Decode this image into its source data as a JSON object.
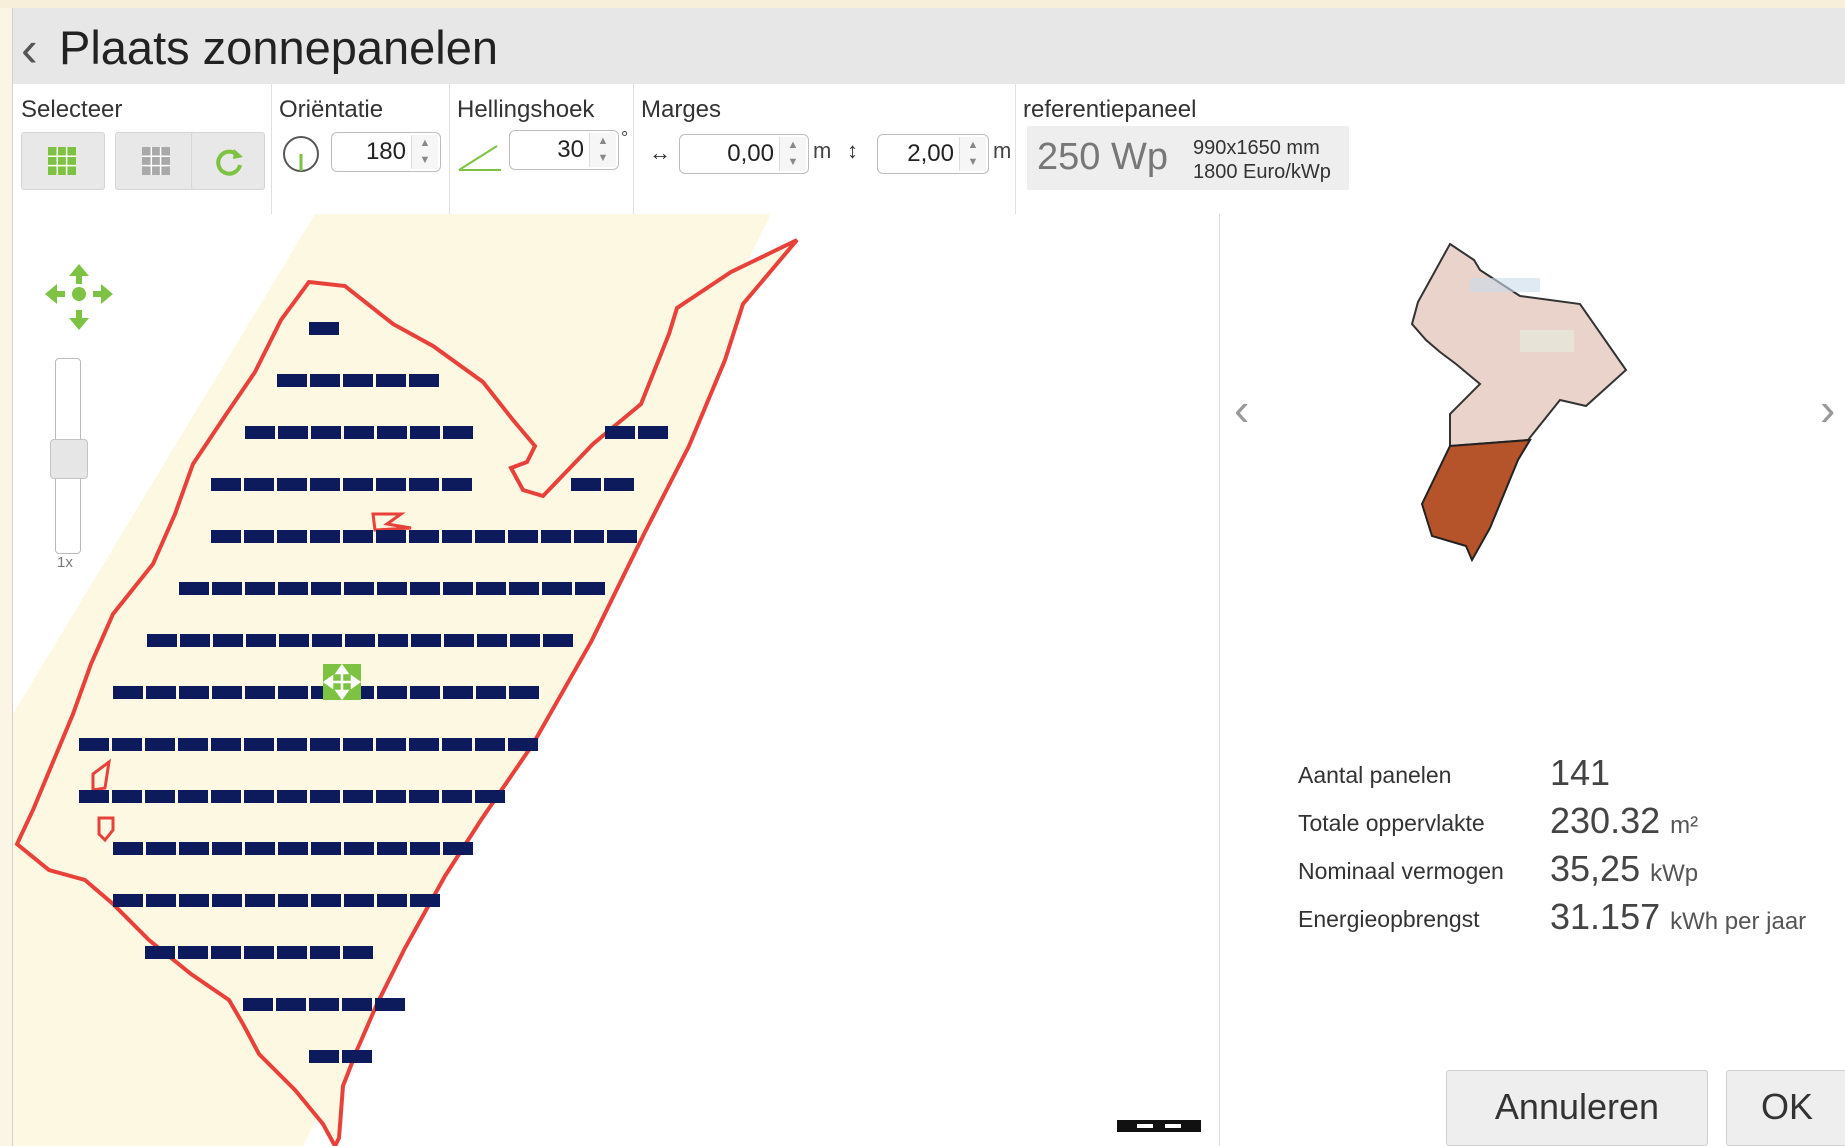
{
  "window": {
    "title": "Plaats zonnepanelen"
  },
  "toolbar": {
    "select": {
      "label": "Selecteer"
    },
    "orientation": {
      "label": "Oriëntatie",
      "value": "180"
    },
    "tilt": {
      "label": "Hellingshoek",
      "value": "30",
      "unit": "°"
    },
    "margins": {
      "label": "Marges",
      "horizontal": "0,00",
      "vertical": "2,00",
      "unit": "m"
    },
    "reference": {
      "label": "referentiepaneel",
      "power": "250 Wp",
      "size": "990x1650 mm",
      "price": "1800 Euro/kWp"
    }
  },
  "map": {
    "zoom_label": "1x"
  },
  "stats": {
    "panel_count": {
      "label": "Aantal panelen",
      "value": "141"
    },
    "total_area": {
      "label": "Totale oppervlakte",
      "value": "230.32",
      "unit": "m²"
    },
    "nominal_power": {
      "label": "Nominaal vermogen",
      "value": "35,25",
      "unit": "kWp"
    },
    "energy_yield": {
      "label": "Energieopbrengst",
      "value": "31.157",
      "unit": "kWh per jaar"
    }
  },
  "buttons": {
    "cancel": "Annuleren",
    "ok": "OK"
  },
  "colors": {
    "accent": "#7dc242",
    "panel": "#0d1a5c",
    "roof_outline": "#e8413a",
    "roof_fill": "#fdf8e2"
  }
}
